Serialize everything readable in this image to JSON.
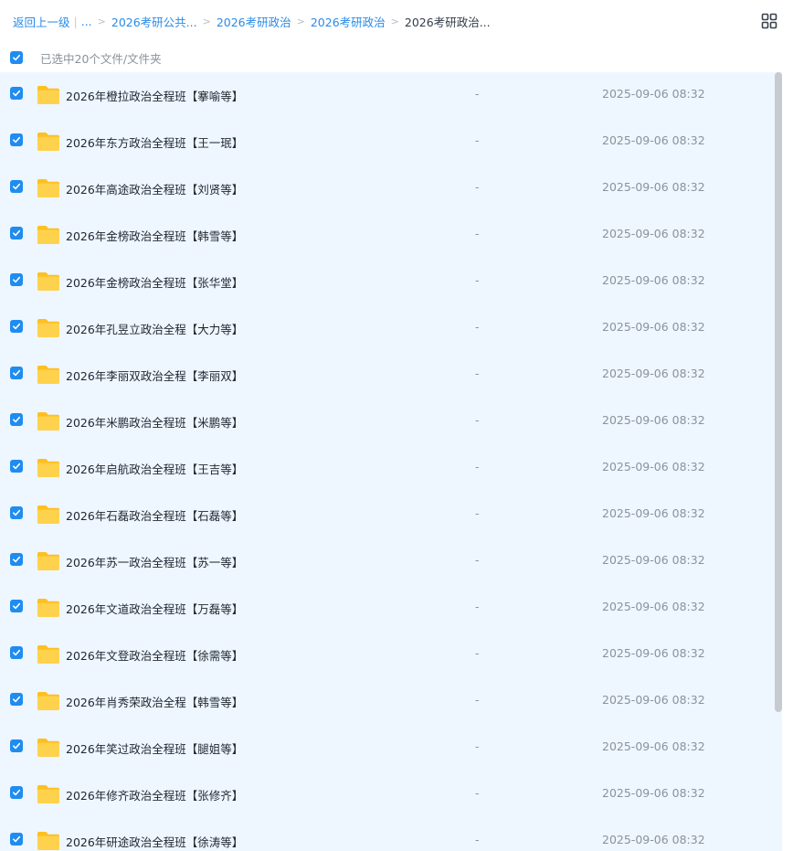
{
  "breadcrumb": {
    "back": "返回上一级",
    "ellipsis": "...",
    "items": [
      "2026考研公共...",
      "2026考研政治",
      "2026考研政治"
    ],
    "current": "2026考研政治..."
  },
  "selection": {
    "text": "已选中20个文件/文件夹"
  },
  "files": [
    {
      "name": "2026年橙拉政治全程班【搴喻等】",
      "size": "-",
      "date": "2025-09-06 08:32"
    },
    {
      "name": "2026年东方政治全程班【王一珉】",
      "size": "-",
      "date": "2025-09-06 08:32"
    },
    {
      "name": "2026年高途政治全程班【刘贤等】",
      "size": "-",
      "date": "2025-09-06 08:32"
    },
    {
      "name": "2026年金榜政治全程班【韩雪等】",
      "size": "-",
      "date": "2025-09-06 08:32"
    },
    {
      "name": "2026年金榜政治全程班【张华堂】",
      "size": "-",
      "date": "2025-09-06 08:32"
    },
    {
      "name": "2026年孔昱立政治全程【大力等】",
      "size": "-",
      "date": "2025-09-06 08:32"
    },
    {
      "name": "2026年李丽双政治全程【李丽双】",
      "size": "-",
      "date": "2025-09-06 08:32"
    },
    {
      "name": "2026年米鹏政治全程班【米鹏等】",
      "size": "-",
      "date": "2025-09-06 08:32"
    },
    {
      "name": "2026年启航政治全程班【王吉等】",
      "size": "-",
      "date": "2025-09-06 08:32"
    },
    {
      "name": "2026年石磊政治全程班【石磊等】",
      "size": "-",
      "date": "2025-09-06 08:32"
    },
    {
      "name": "2026年苏一政治全程班【苏一等】",
      "size": "-",
      "date": "2025-09-06 08:32"
    },
    {
      "name": "2026年文道政治全程班【万磊等】",
      "size": "-",
      "date": "2025-09-06 08:32"
    },
    {
      "name": "2026年文登政治全程班【徐需等】",
      "size": "-",
      "date": "2025-09-06 08:32"
    },
    {
      "name": "2026年肖秀荣政治全程【韩雪等】",
      "size": "-",
      "date": "2025-09-06 08:32"
    },
    {
      "name": "2026年笑过政治全程班【腿姐等】",
      "size": "-",
      "date": "2025-09-06 08:32"
    },
    {
      "name": "2026年修齐政治全程班【张修齐】",
      "size": "-",
      "date": "2025-09-06 08:32"
    },
    {
      "name": "2026年研途政治全程班【徐涛等】",
      "size": "-",
      "date": "2025-09-06 08:32"
    }
  ],
  "icons": {
    "checkbox": "checkbox-checked-icon",
    "folder": "folder-icon",
    "view": "grid-view-icon"
  },
  "colors": {
    "accent": "#1f8cf0",
    "link": "#2a8be8",
    "list_bg": "#eef6ff",
    "folder": "#ffc933"
  }
}
